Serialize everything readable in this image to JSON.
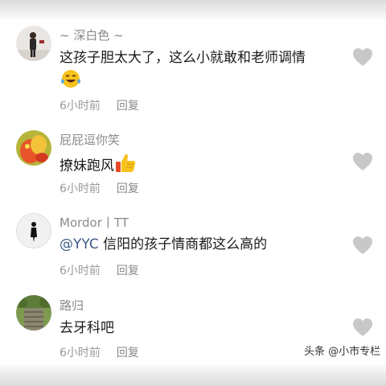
{
  "comments": [
    {
      "username": "~ 深白色 ~",
      "text": "这孩子胆太大了，这么小就敢和老师调情",
      "emoji": "laughing-tears-emoji",
      "time": "6小时前",
      "reply_label": "回复"
    },
    {
      "username": "屁屁逗你笑",
      "text": "撩妹跑风",
      "emoji": "thumbs-up-emoji",
      "time": "6小时前",
      "reply_label": "回复"
    },
    {
      "username": "Mordor丨TT",
      "mention": "@YYC",
      "text": " 信阳的孩子情商都这么高的",
      "time": "6小时前",
      "reply_label": "回复"
    },
    {
      "username": "路归",
      "text": "去牙科吧",
      "time": "6小时前",
      "reply_label": "回复"
    }
  ],
  "watermark": "头条 @小市专栏",
  "colors": {
    "heart": "#c8c8c8",
    "username": "#8a8a8a",
    "mention": "#3b5a86"
  }
}
